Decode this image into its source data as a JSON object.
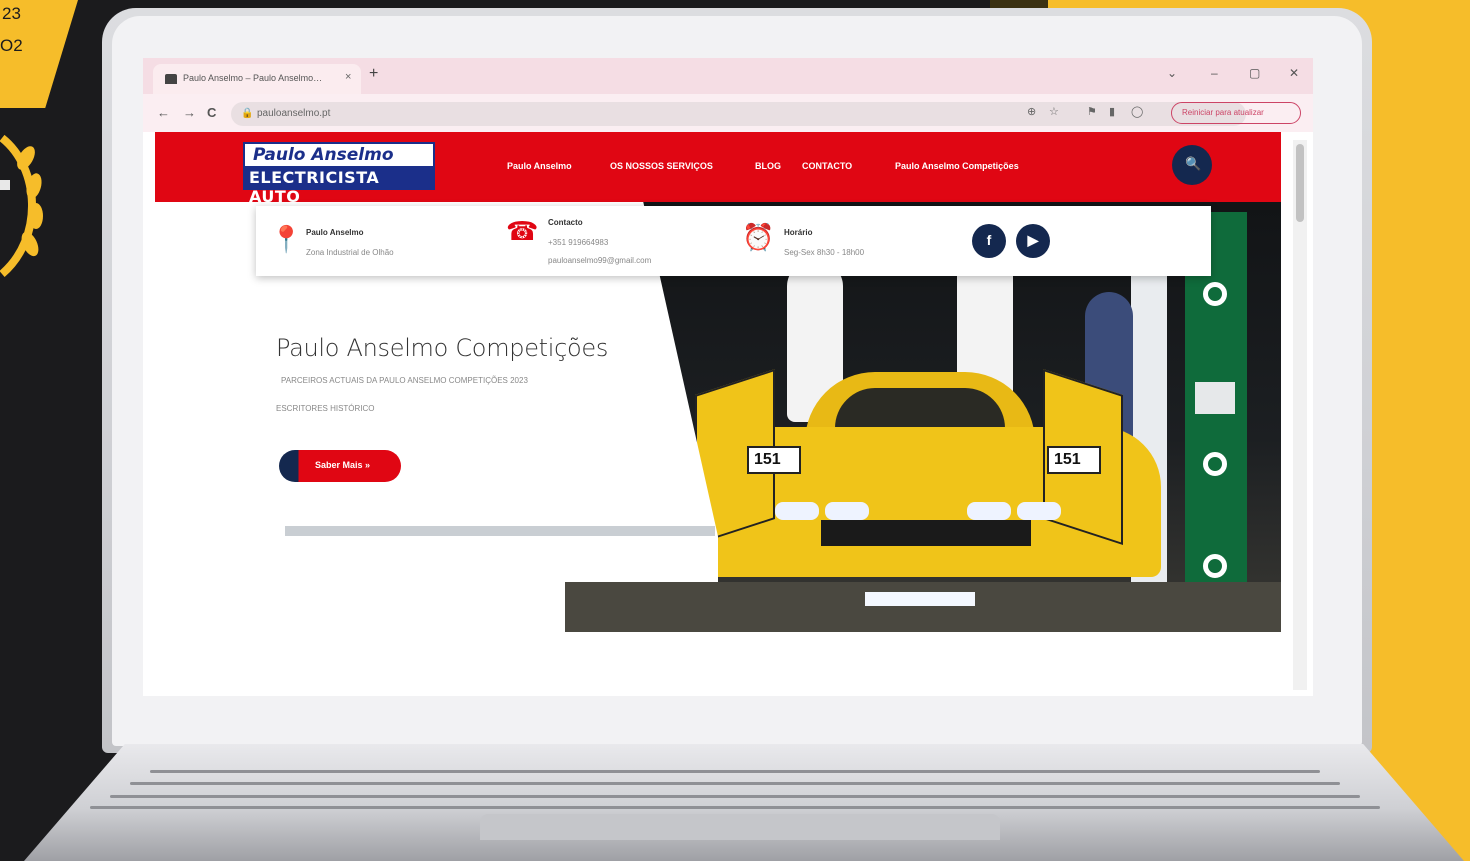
{
  "background": {
    "accent_yellow": "#f6bd2a",
    "dark": "#1b1b1d",
    "year_line1": "23",
    "year_line2": "O2"
  },
  "browser": {
    "tab_title": "Paulo Anselmo – Paulo Anselmo…",
    "tab_close": "×",
    "new_tab": "+",
    "url": "pauloanselmo.pt",
    "back": "←",
    "forward": "→",
    "reload": "C",
    "lock": "🔒",
    "window_controls": [
      "⌄",
      "–",
      "▢",
      "✕"
    ],
    "extensions": [
      "⊕",
      "☆",
      "⚑",
      "▮",
      "◯"
    ],
    "update_label": "Reiniciar para atualizar"
  },
  "site": {
    "brand_color": "#e00613",
    "navy_color": "#14284f",
    "logo_top": "Paulo Anselmo",
    "logo_bottom": "ELECTRICISTA AUTO",
    "menu": [
      "Paulo Anselmo",
      "OS NOSSOS SERVIÇOS",
      "BLOG",
      "CONTACTO",
      "Paulo Anselmo Competições"
    ],
    "search_icon": "🔍",
    "info": {
      "location_label": "Paulo Anselmo",
      "location_value": "Zona Industrial de Olhão",
      "contact_label": "Contacto",
      "contact_phone": "+351 919664983",
      "contact_email": "pauloanselmo99@gmail.com",
      "hours_label": "Horário",
      "hours_value": "Seg-Sex 8h30 - 18h00"
    },
    "social": {
      "facebook": "f",
      "youtube": "▶"
    },
    "hero": {
      "title": "Paulo Anselmo Competições",
      "subtitle1": "PARCEIROS ACTUAIS DA PAULO ANSELMO COMPETIÇÕES 2023",
      "subtitle2": "ESCRITORES HISTÓRICO",
      "cta": "Saber Mais »",
      "plate_number": "151"
    }
  }
}
